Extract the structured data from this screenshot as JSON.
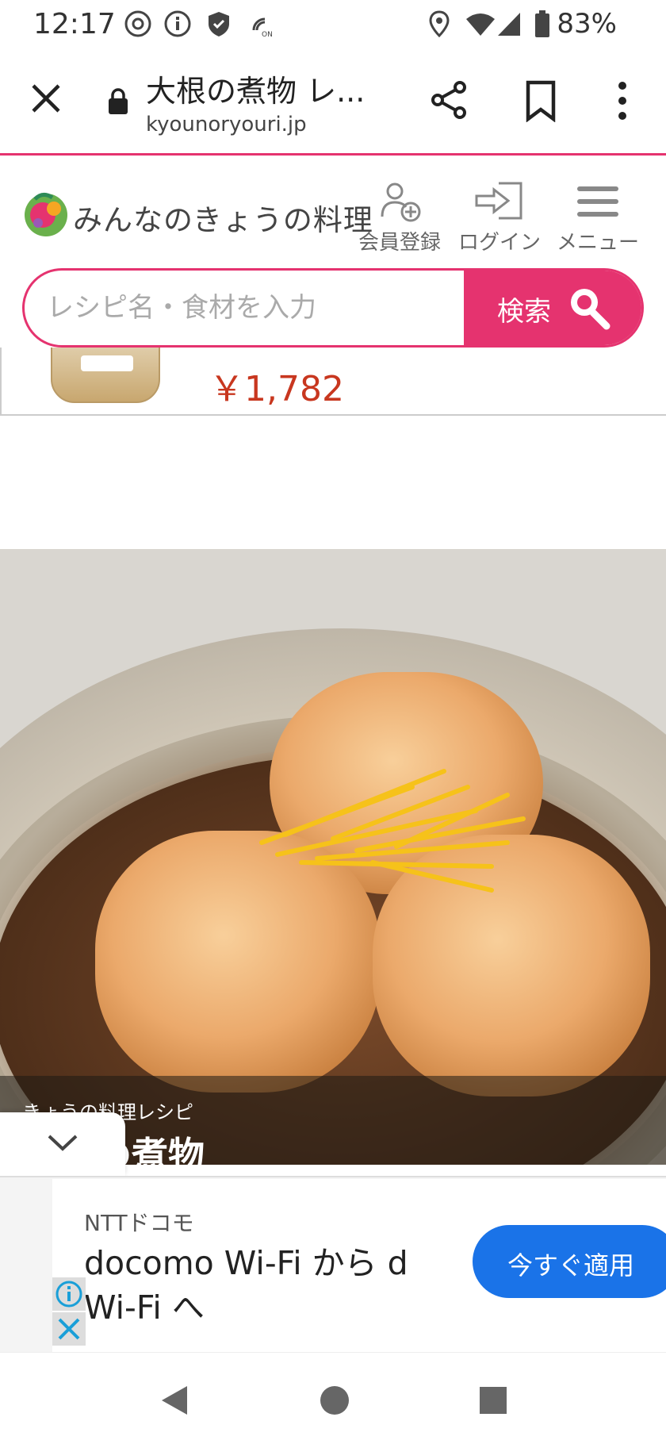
{
  "status_bar": {
    "time": "12:17",
    "battery_percent": "83%",
    "icons": [
      "chrome-icon",
      "info-icon",
      "shield-icon",
      "nfc-icon",
      "location-icon",
      "wifi-icon",
      "signal-icon",
      "battery-icon"
    ]
  },
  "browser": {
    "page_title": "大根の煮物 レ...",
    "url": "kyounoryouri.jp",
    "accent_color": "#e5336f"
  },
  "site_header": {
    "logo_text": "みんなのきょうの料理",
    "register_label": "会員登録",
    "login_label": "ログイン",
    "menu_label": "メニュー"
  },
  "search": {
    "placeholder": "レシピ名・食材を入力",
    "button_label": "検索"
  },
  "product": {
    "price": "￥1,782"
  },
  "hero": {
    "caption_small": "きょうの料理レシピ",
    "caption_title": "大根の煮物"
  },
  "ad": {
    "advertiser": "NTTドコモ",
    "headline": "docomo Wi-Fi から d Wi-Fi へ",
    "cta_label": "今すぐ適用",
    "cta_color": "#1a73e8"
  }
}
